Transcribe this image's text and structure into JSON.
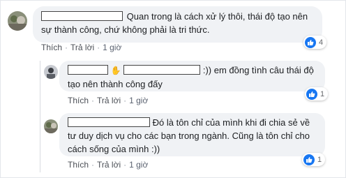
{
  "comments": [
    {
      "text_a": "Quan trong là cách xử lý thôi, thái độ tạo nên",
      "text_b": "sự thành công, chứ không phải là tri thức.",
      "actions": {
        "like": "Thích",
        "reply": "Trả lời",
        "time": "1 giờ"
      },
      "reaction_count": "4"
    },
    {
      "text_a": ":)) em đồng tình câu thái độ",
      "text_b": "tạo nên thành công đấy",
      "hand_glyph": "✋",
      "actions": {
        "like": "Thích",
        "reply": "Trả lời",
        "time": "1 giờ"
      },
      "reaction_count": "1"
    },
    {
      "text_a": "Đó là tôn chỉ của mình khi đi chia sẻ về",
      "text_b": "tư duy dịch vụ cho các bạn trong ngành. Cũng là tôn chỉ cho",
      "text_c": "cách sống của mình :))",
      "actions": {
        "like": "Thích",
        "reply": "Trả lời",
        "time": "1 giờ"
      },
      "reaction_count": "1"
    }
  ],
  "icons": {
    "reaction": "like-thumbs-up-icon"
  },
  "colors": {
    "bubble": "#f0f2f5",
    "like_blue": "#1877f2",
    "link": "#4b4f56"
  }
}
